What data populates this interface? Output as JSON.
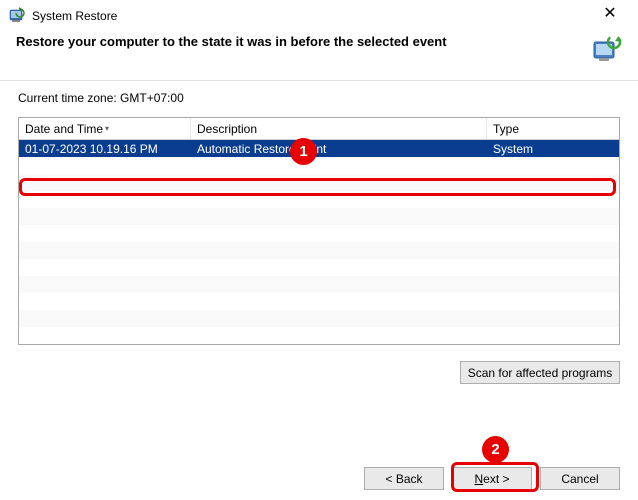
{
  "window": {
    "title": "System Restore"
  },
  "header": {
    "subtitle": "Restore your computer to the state it was in before the selected event"
  },
  "timezone_label": "Current time zone: GMT+07:00",
  "table": {
    "columns": {
      "date": "Date and Time",
      "desc": "Description",
      "type": "Type"
    },
    "rows": [
      {
        "date": "01-07-2023 10.19.16 PM",
        "desc": "Automatic Restore Point",
        "type": "System",
        "selected": true
      }
    ]
  },
  "buttons": {
    "scan": "Scan for affected programs",
    "back": "< Back",
    "next": "Next >",
    "cancel": "Cancel"
  },
  "annotations": {
    "one": "1",
    "two": "2"
  }
}
